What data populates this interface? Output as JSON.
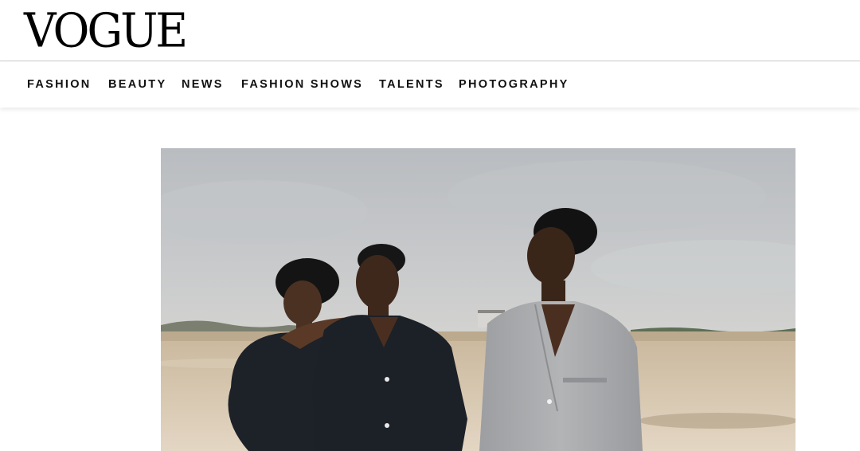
{
  "site": {
    "logo": "VOGUE"
  },
  "nav": {
    "items": [
      {
        "label": "FASHION"
      },
      {
        "label": "BEAUTY"
      },
      {
        "label": "NEWS"
      },
      {
        "label": "FASHION SHOWS"
      },
      {
        "label": "TALENTS"
      },
      {
        "label": "PHOTOGRAPHY"
      }
    ]
  }
}
